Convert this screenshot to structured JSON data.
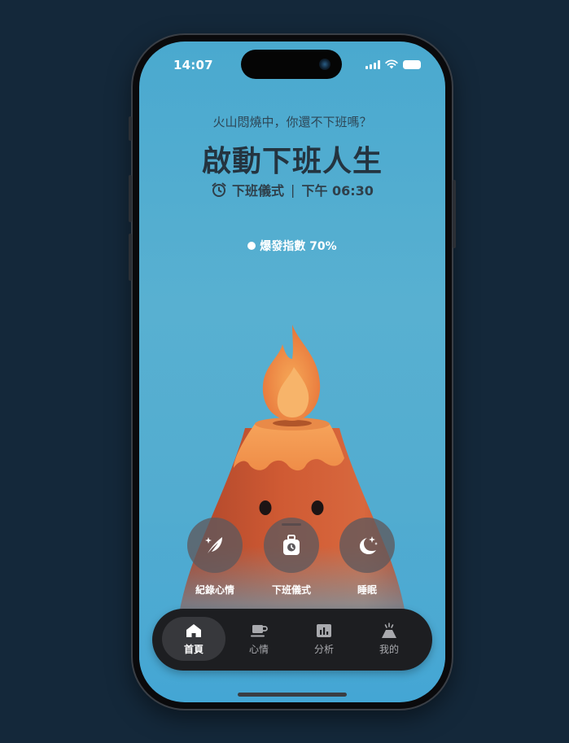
{
  "status_bar": {
    "time": "14:07"
  },
  "header": {
    "subtitle": "火山悶燒中，你還不下班嗎？",
    "title": "啟動下班人生",
    "ritual_label": "下班儀式",
    "separator": "|",
    "ritual_time": "下午 06:30"
  },
  "eruption": {
    "label": "爆發指數 70%",
    "value_percent": 70
  },
  "actions": [
    {
      "label": "紀錄心情",
      "icon": "feather-icon"
    },
    {
      "label": "下班儀式",
      "icon": "timer-bag-icon"
    },
    {
      "label": "睡眠",
      "icon": "moon-stars-icon"
    }
  ],
  "nav": {
    "active": "首頁",
    "items": [
      {
        "label": "首頁",
        "icon": "home-icon"
      },
      {
        "label": "心情",
        "icon": "coffee-cup-icon"
      },
      {
        "label": "分析",
        "icon": "bar-chart-icon"
      },
      {
        "label": "我的",
        "icon": "volcano-icon"
      }
    ]
  },
  "colors": {
    "background": "#13293a",
    "screen": "#52acd0",
    "volcano_body": "#c9532e",
    "lava": "#f39a4e",
    "tabbar": "#1d1e21"
  }
}
